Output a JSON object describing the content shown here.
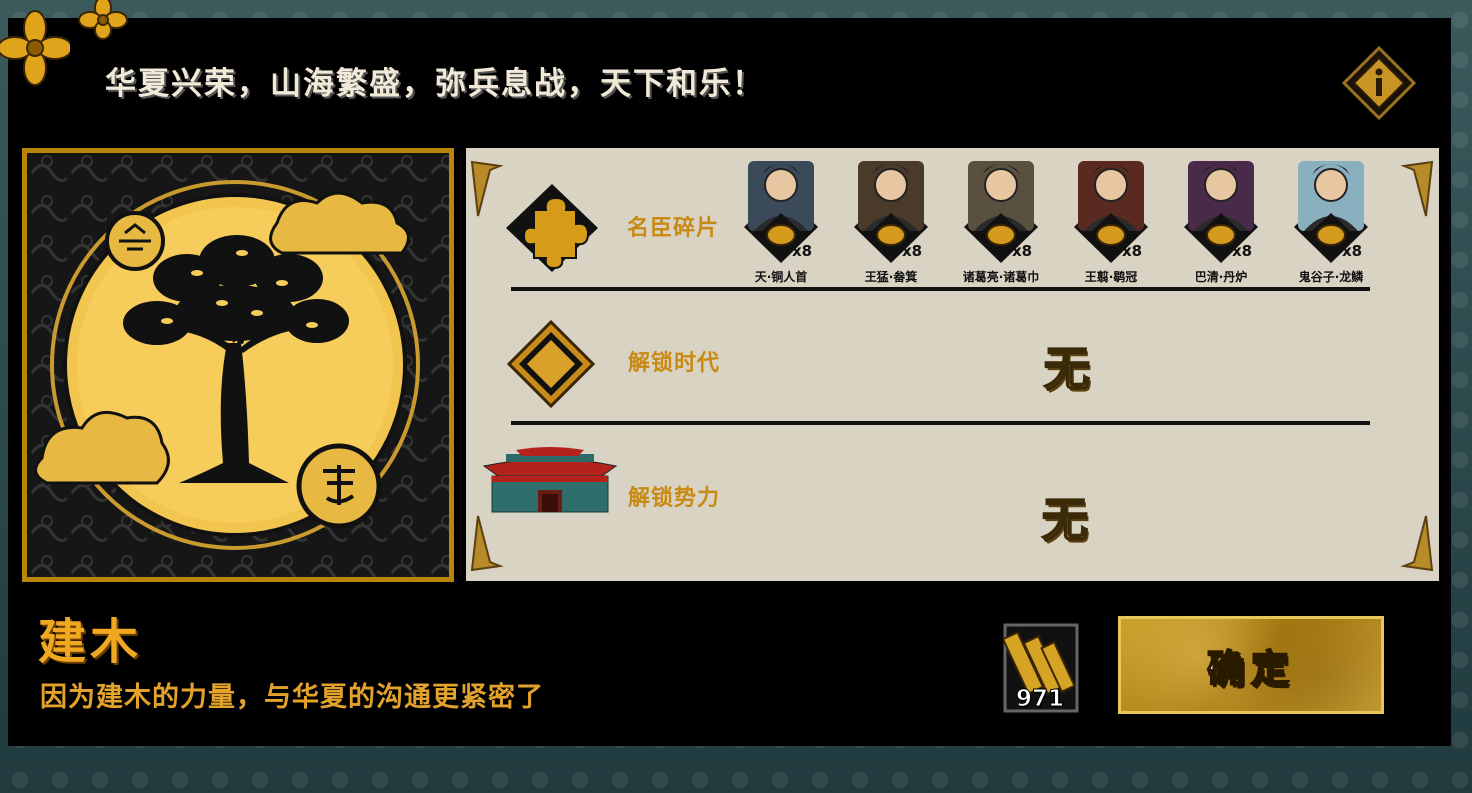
{
  "header": {
    "text": "华夏兴荣，山海繁盛，弥兵息战，天下和乐！",
    "info_icon": "info-diamond-icon"
  },
  "rewards": {
    "fragments": {
      "label": "名臣碎片",
      "icon": "puzzle-piece-icon",
      "heroes": [
        {
          "name": "天·铜人首",
          "count": "x8"
        },
        {
          "name": "王猛·畚箕",
          "count": "x8"
        },
        {
          "name": "诸葛亮·诸葛巾",
          "count": "x8"
        },
        {
          "name": "王翦·鹖冠",
          "count": "x8"
        },
        {
          "name": "巴清·丹炉",
          "count": "x8"
        },
        {
          "name": "鬼谷子·龙鳞",
          "count": "x8"
        }
      ]
    },
    "era": {
      "label": "解锁时代",
      "value": "无",
      "icon": "gold-diamond-icon"
    },
    "faction": {
      "label": "解锁势力",
      "value": "无",
      "icon": "palace-icon"
    }
  },
  "emblem": {
    "name": "建木",
    "badge": "tree-emblem"
  },
  "description": "因为建木的力量，与华夏的沟通更紧密了",
  "resource": {
    "count": "971",
    "icon": "scroll-bundle-icon"
  },
  "confirm_label": "确定",
  "colors": {
    "gold": "#c88a12",
    "card": "#d9d3c3",
    "panel": "#000000"
  }
}
